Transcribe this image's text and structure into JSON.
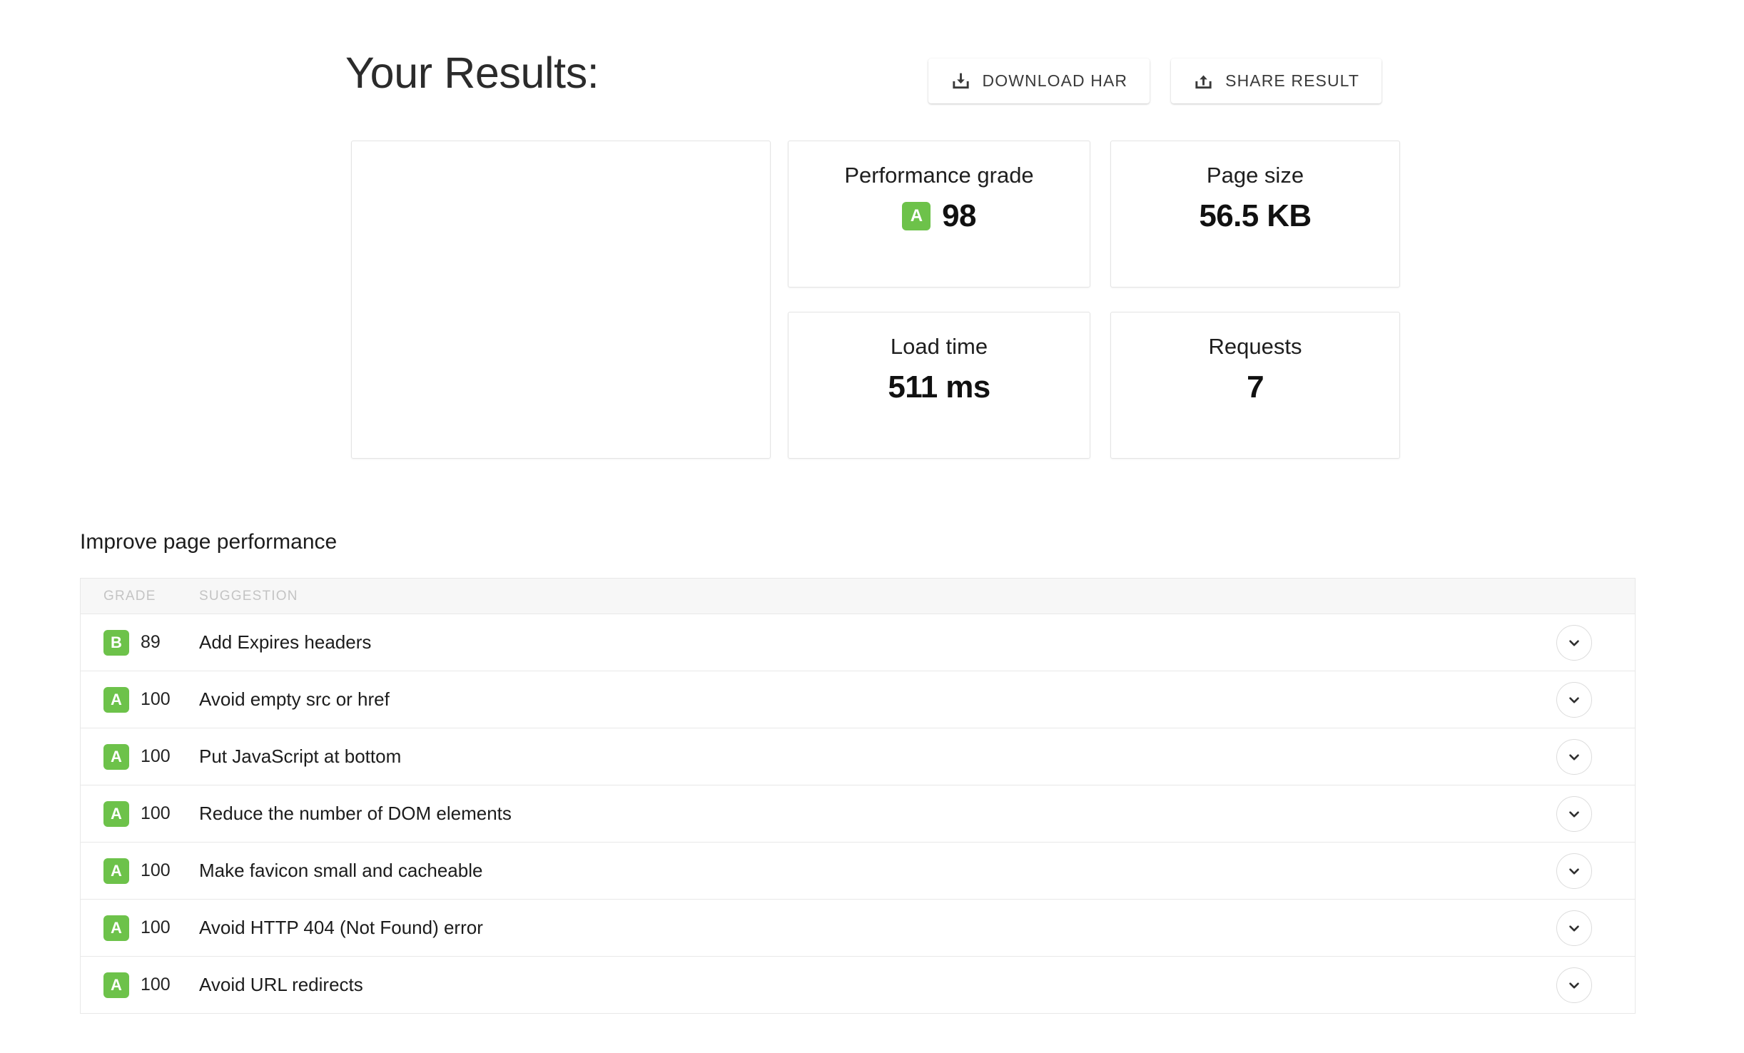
{
  "header": {
    "title": "Your Results:",
    "actions": [
      {
        "label": "DOWNLOAD HAR",
        "icon": "download-icon"
      },
      {
        "label": "SHARE RESULT",
        "icon": "share-icon"
      }
    ]
  },
  "summary": {
    "preview": {
      "content": ""
    },
    "cards": [
      {
        "title": "Performance grade",
        "grade": "A",
        "value": "98"
      },
      {
        "title": "Page size",
        "value": "56.5 KB"
      },
      {
        "title": "Load time",
        "value": "511 ms"
      },
      {
        "title": "Requests",
        "value": "7"
      }
    ]
  },
  "suggestions": {
    "section_title": "Improve page performance",
    "columns": {
      "grade": "GRADE",
      "suggestion": "SUGGESTION"
    },
    "rows": [
      {
        "grade": "B",
        "score": "89",
        "suggestion": "Add Expires headers",
        "toggle": "chevron-down-icon"
      },
      {
        "grade": "A",
        "score": "100",
        "suggestion": "Avoid empty src or href",
        "toggle": "chevron-down-icon"
      },
      {
        "grade": "A",
        "score": "100",
        "suggestion": "Put JavaScript at bottom",
        "toggle": "chevron-down-icon"
      },
      {
        "grade": "A",
        "score": "100",
        "suggestion": "Reduce the number of DOM elements",
        "toggle": "chevron-down-icon"
      },
      {
        "grade": "A",
        "score": "100",
        "suggestion": "Make favicon small and cacheable",
        "toggle": "chevron-down-icon"
      },
      {
        "grade": "A",
        "score": "100",
        "suggestion": "Avoid HTTP 404 (Not Found) error",
        "toggle": "chevron-down-icon"
      },
      {
        "grade": "A",
        "score": "100",
        "suggestion": "Avoid URL redirects",
        "toggle": "chevron-down-icon"
      }
    ]
  },
  "colors": {
    "grade_green": "#6dc24a",
    "text_primary": "#1c1c1c",
    "header_band": "#f7f7f7",
    "border": "#e8e8e8"
  }
}
